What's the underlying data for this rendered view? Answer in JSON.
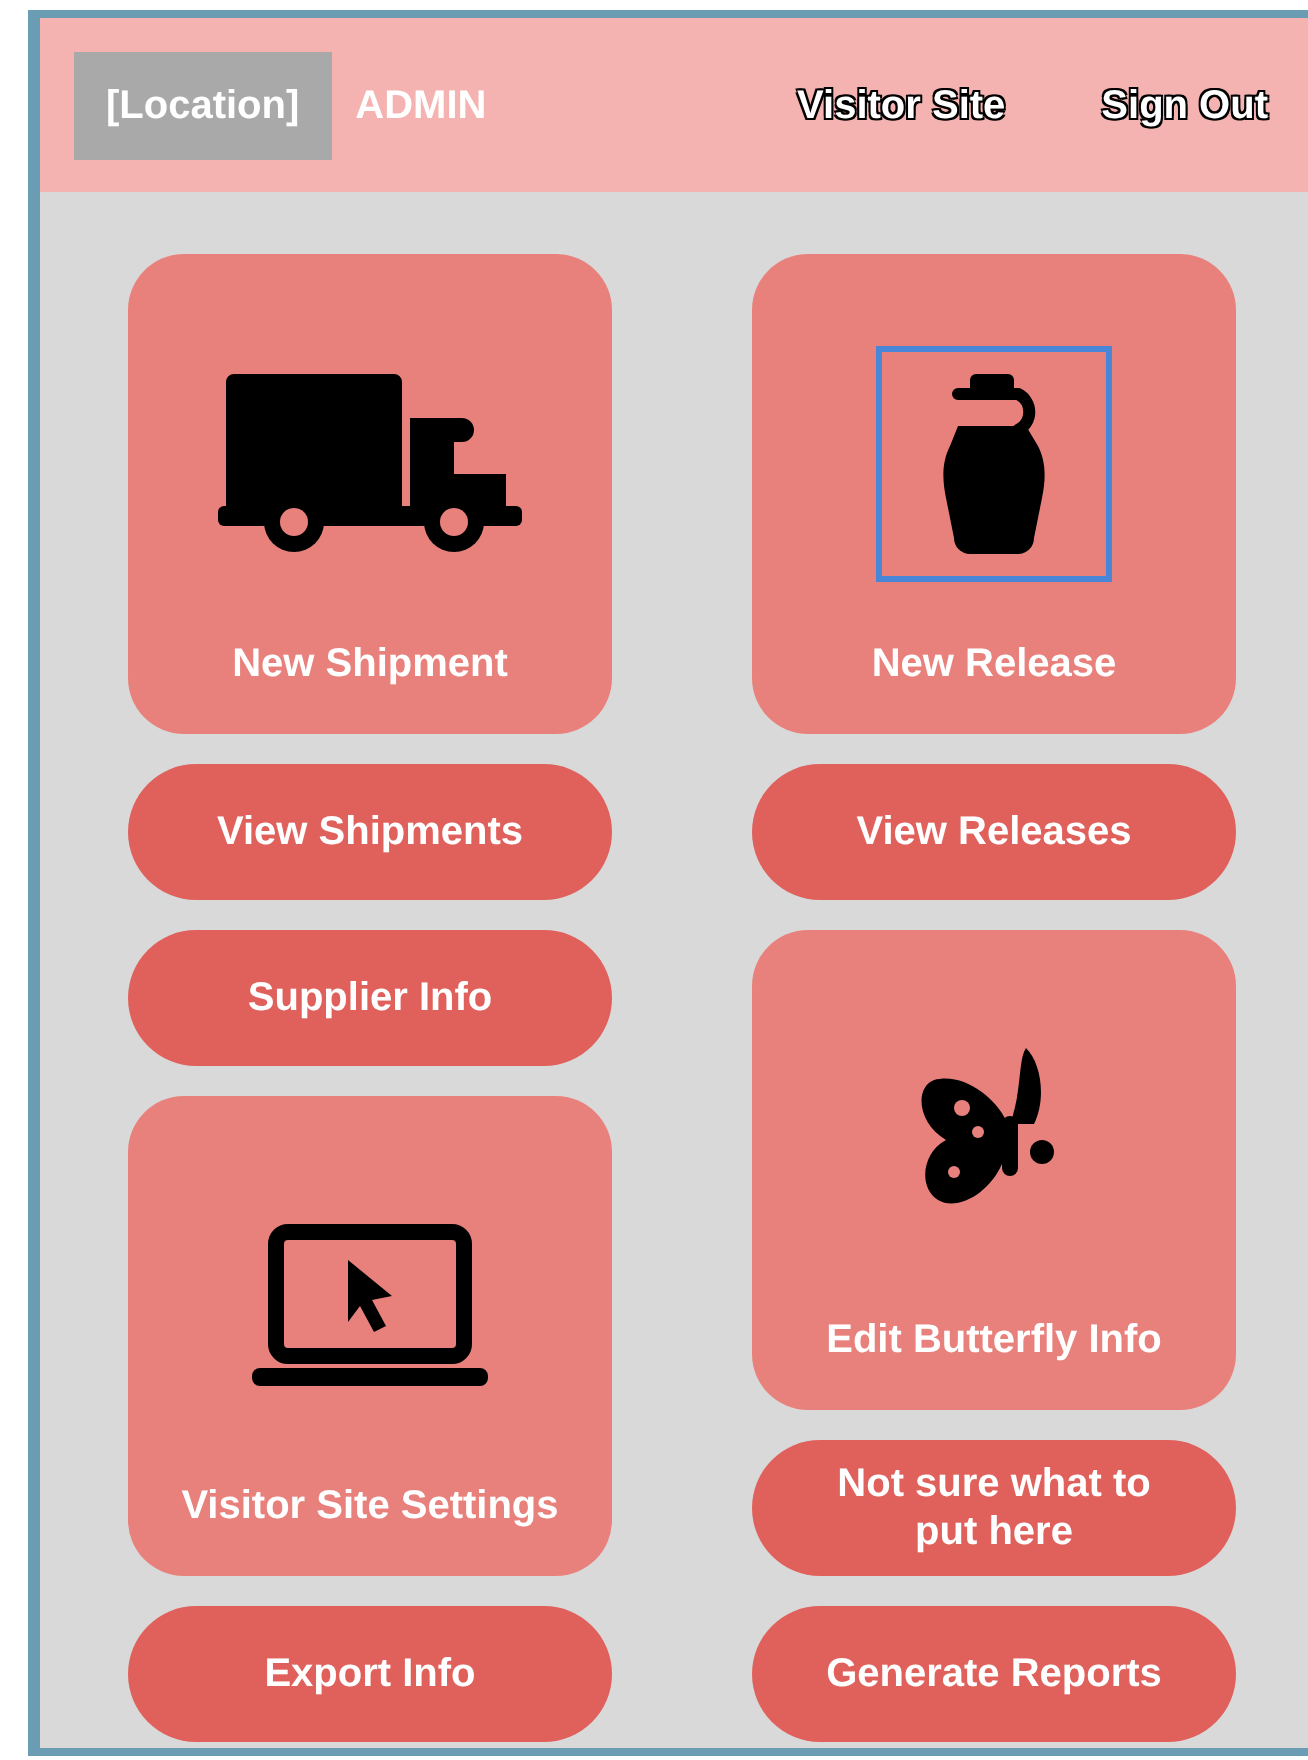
{
  "header": {
    "location": "[Location]",
    "role": "ADMIN",
    "links": [
      "Visitor Site",
      "Sign Out"
    ]
  },
  "columns": [
    {
      "tiles": [
        {
          "kind": "card",
          "label": "New Shipment",
          "focused": false
        },
        {
          "kind": "button",
          "label": "View Shipments"
        },
        {
          "kind": "button",
          "label": "Supplier Info"
        },
        {
          "kind": "card",
          "label": "Visitor Site Settings",
          "focused": false
        },
        {
          "kind": "button",
          "label": "Export Info"
        }
      ]
    },
    {
      "tiles": [
        {
          "kind": "card",
          "label": "New Release",
          "focused": true
        },
        {
          "kind": "button",
          "label": "View Releases"
        },
        {
          "kind": "card",
          "label": "Edit Butterfly Info",
          "focused": false
        },
        {
          "kind": "button",
          "label": "Not sure what to put here"
        },
        {
          "kind": "button",
          "label": "Generate Reports"
        }
      ]
    }
  ]
}
